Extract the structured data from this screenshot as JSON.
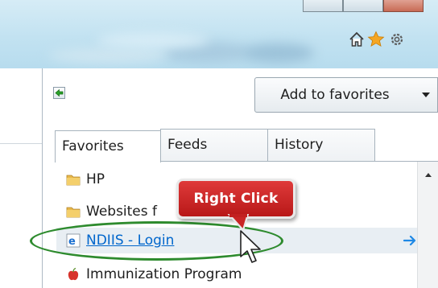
{
  "toolbar": {
    "home_icon": "home-icon",
    "favorites_icon": "favorites-star-icon",
    "tools_icon": "gear-icon"
  },
  "favorites_center": {
    "pin_icon": "pin-favorites-center-icon",
    "add_to_favorites_label": "Add to favorites",
    "tabs": [
      {
        "label": "Favorites",
        "active": true
      },
      {
        "label": "Feeds",
        "active": false
      },
      {
        "label": "History",
        "active": false
      }
    ],
    "items": [
      {
        "label": "HP",
        "icon": "folder-icon"
      },
      {
        "label": "Websites f",
        "icon": "folder-icon"
      },
      {
        "label": "NDIIS - Login",
        "icon": "ie-page-icon",
        "hovered": true
      },
      {
        "label": "Immunization Program",
        "icon": "apple-favicon-icon"
      }
    ]
  },
  "annotation": {
    "callout_text": "Right Click",
    "callout_color": "#c92525",
    "highlight_color": "#2e8b2e"
  },
  "colors": {
    "link": "#0066cc",
    "arrow": "#1e88e5",
    "star": "#f5a623"
  }
}
